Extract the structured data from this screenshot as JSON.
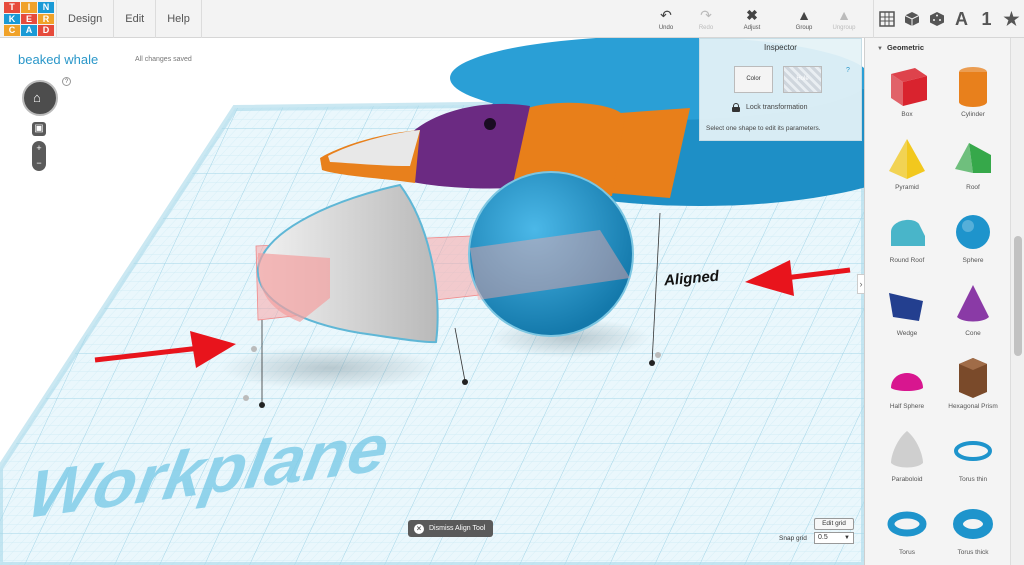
{
  "app": {
    "logo_letters": [
      "T",
      "I",
      "N",
      "K",
      "E",
      "R",
      "C",
      "A",
      "D"
    ],
    "menu": [
      "Design",
      "Edit",
      "Help"
    ],
    "design_title": "beaked whale",
    "save_status": "All changes saved",
    "help_mark": "?"
  },
  "toolbar": {
    "undo": "Undo",
    "redo": "Redo",
    "adjust": "Adjust",
    "group": "Group",
    "ungroup": "Ungroup",
    "view_label_a": "A",
    "view_label_1": "1"
  },
  "inspector": {
    "title": "Inspector",
    "color_label": "Color",
    "hole_label": "Hole",
    "help": "?",
    "lock_label": "Lock transformation",
    "hint": "Select one shape to edit its parameters."
  },
  "scene": {
    "workplane_text": "Workplane",
    "annotation": "Aligned",
    "colors": {
      "grid_line": "#bfe3ef",
      "grid_bg": "#e8f6fb",
      "whale_body": "#1e8fc6",
      "whale_head": "#6b2a82",
      "whale_band": "#e87f1a",
      "sphere": "#2a9fd6",
      "paraboloid": "#d9d9d9",
      "alignment_plane": "#f7a6a6",
      "arrow": "#e8141c"
    }
  },
  "bottom": {
    "dismiss_label": "Dismiss Align Tool",
    "edit_grid": "Edit grid",
    "snap_label": "Snap grid",
    "snap_value": "0.5"
  },
  "panel": {
    "category": "Geometric",
    "shapes": [
      {
        "name": "Box",
        "icon": "box-icon",
        "color": "#d9232e"
      },
      {
        "name": "Cylinder",
        "icon": "cylinder-icon",
        "color": "#e8801c"
      },
      {
        "name": "Pyramid",
        "icon": "pyramid-icon",
        "color": "#f2c81e"
      },
      {
        "name": "Roof",
        "icon": "roof-icon",
        "color": "#36a84a"
      },
      {
        "name": "Round Roof",
        "icon": "round-roof-icon",
        "color": "#49b5c9"
      },
      {
        "name": "Sphere",
        "icon": "sphere-icon",
        "color": "#1e94cc"
      },
      {
        "name": "Wedge",
        "icon": "wedge-icon",
        "color": "#233f8f"
      },
      {
        "name": "Cone",
        "icon": "cone-icon",
        "color": "#8a3aa6"
      },
      {
        "name": "Half Sphere",
        "icon": "half-sphere-icon",
        "color": "#d8168f"
      },
      {
        "name": "Hexagonal Prism",
        "icon": "hexagonal-prism-icon",
        "color": "#7a4a2a"
      },
      {
        "name": "Paraboloid",
        "icon": "paraboloid-icon",
        "color": "#cfcfcf"
      },
      {
        "name": "Torus thin",
        "icon": "torus-thin-icon",
        "color": "#1e94cc"
      },
      {
        "name": "Torus",
        "icon": "torus-icon",
        "color": "#1e94cc"
      },
      {
        "name": "Torus thick",
        "icon": "torus-thick-icon",
        "color": "#1e94cc"
      }
    ]
  }
}
